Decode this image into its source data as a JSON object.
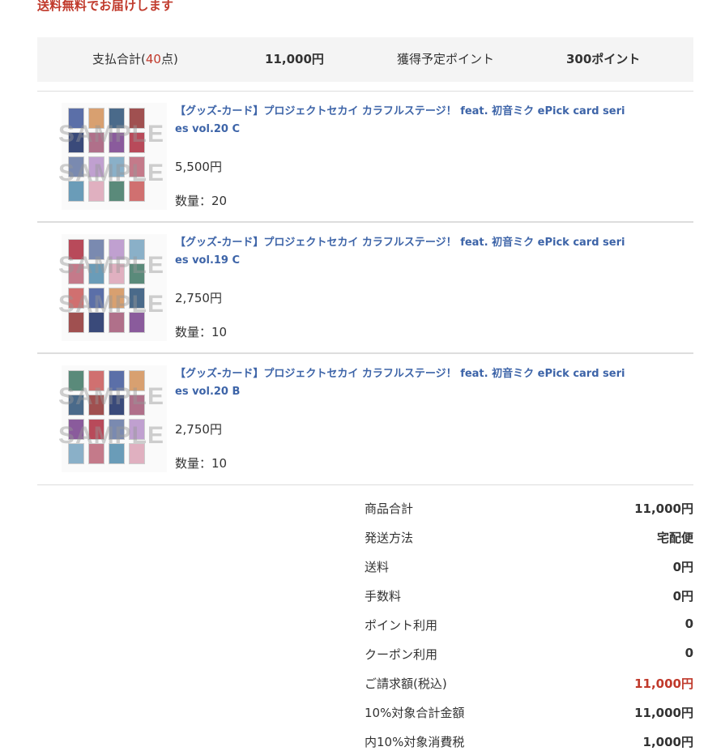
{
  "notice": "送料無料でお届けします",
  "summary": {
    "total_label_prefix": "支払合計(",
    "total_count": "40",
    "total_label_suffix": "点)",
    "total_amount": "11,000円",
    "points_label": "獲得予定ポイント",
    "points_value": "300ポイント"
  },
  "items": [
    {
      "title": "【グッズ-カード】プロジェクトセカイ カラフルステージ！ feat. 初音ミク ePick card series vol.20 C",
      "price": "5,500円",
      "quantity": "数量：20",
      "watermark": "SAMPLE"
    },
    {
      "title": "【グッズ-カード】プロジェクトセカイ カラフルステージ！ feat. 初音ミク ePick card series vol.19 C",
      "price": "2,750円",
      "quantity": "数量：10",
      "watermark": "SAMPLE"
    },
    {
      "title": "【グッズ-カード】プロジェクトセカイ カラフルステージ！ feat. 初音ミク ePick card series vol.20 B",
      "price": "2,750円",
      "quantity": "数量：10",
      "watermark": "SAMPLE"
    }
  ],
  "totals": [
    {
      "label": "商品合計",
      "value": "11,000円"
    },
    {
      "label": "発送方法",
      "value": "宅配便"
    },
    {
      "label": "送料",
      "value": "0円"
    },
    {
      "label": "手数料",
      "value": "0円"
    },
    {
      "label": "ポイント利用",
      "value": "0"
    },
    {
      "label": "クーポン利用",
      "value": "0"
    },
    {
      "label": "ご請求額(税込)",
      "value": "11,000円"
    },
    {
      "label": "10%対象合計金額",
      "value": "11,000円"
    },
    {
      "label": "内10%対象消費税",
      "value": "1,000円"
    }
  ],
  "colors": {
    "accent": "#c0392b",
    "link": "#3d64a8",
    "bar_bg": "#f4f4f4"
  }
}
